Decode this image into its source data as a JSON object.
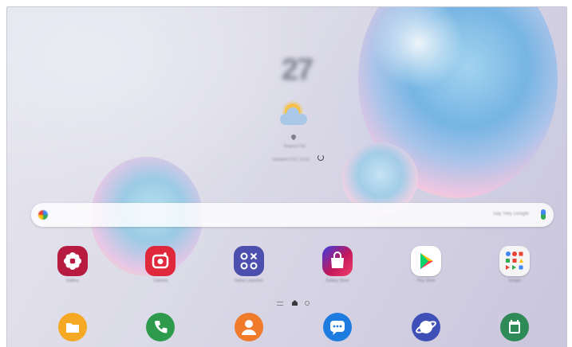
{
  "homescreen": {
    "clock_time": "27",
    "weather": {
      "location": "Nagoya City",
      "updated": "Updated 07/27 10:30",
      "icon": "partly-cloudy-icon"
    },
    "search": {
      "placeholder": "Say 'Hey Google'",
      "logo_icon": "google-g-icon",
      "mic_icon": "microphone-icon"
    },
    "apps": [
      {
        "label": "Gallery",
        "icon": "gallery-flower-icon",
        "color": "#b71c40"
      },
      {
        "label": "Camera",
        "icon": "camera-icon",
        "color": "#e0283d"
      },
      {
        "label": "Game Launcher",
        "icon": "game-launcher-icon",
        "color": "#4d4fae"
      },
      {
        "label": "Galaxy Store",
        "icon": "store-bag-icon",
        "color": "#c2185b"
      },
      {
        "label": "Play Store",
        "icon": "play-store-icon",
        "color": "#ffffff"
      },
      {
        "label": "Google",
        "icon": "google-folder-icon",
        "color": "#f5f5f5"
      }
    ],
    "page_indicator": {
      "items": [
        "menu-lines-icon",
        "home-icon",
        "page-dot-icon"
      ]
    },
    "dock": [
      {
        "label": "My Files",
        "icon": "folder-icon",
        "color": "#f4a823"
      },
      {
        "label": "Phone",
        "icon": "phone-icon",
        "color": "#2e9b4c"
      },
      {
        "label": "Contacts",
        "icon": "contacts-icon",
        "color": "#f07b2b"
      },
      {
        "label": "Messages",
        "icon": "messages-icon",
        "color": "#1e7ce0"
      },
      {
        "label": "Internet",
        "icon": "internet-icon",
        "color": "#3f4fb8"
      },
      {
        "label": "Calendar",
        "icon": "calendar-icon",
        "color": "#2e8a57"
      }
    ]
  }
}
